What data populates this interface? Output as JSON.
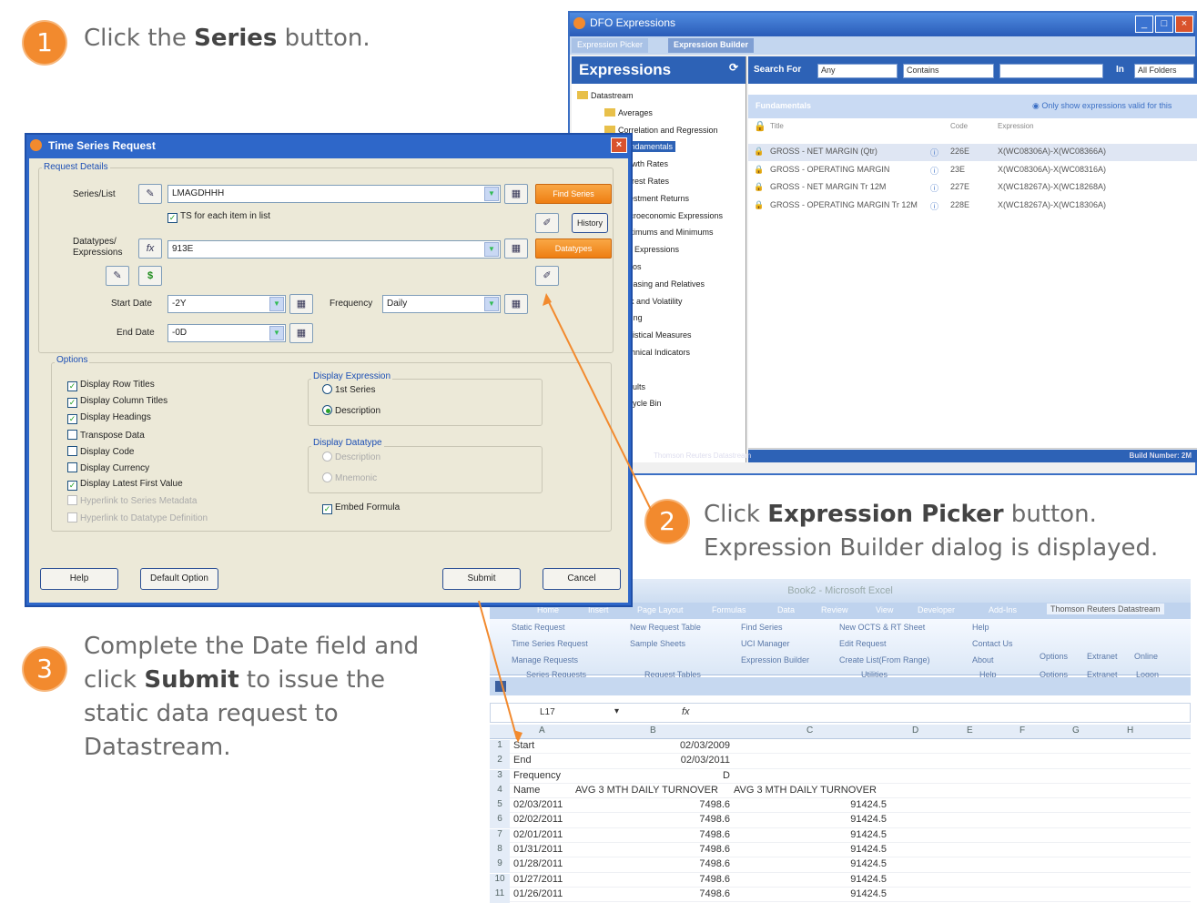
{
  "steps": [
    {
      "num": "1",
      "pre": "Click the ",
      "bold": "Series",
      "post": " button."
    },
    {
      "num": "2",
      "line1_bold": "Expression Picker",
      "line1_post": " button.",
      "line1_pre": "Click ",
      "line2": "Expression Builder  dialog is displayed."
    },
    {
      "num": "3",
      "line1": "Complete the Date field and",
      "line2_bold": "Submit",
      "line2_pre": "click ",
      "line2_post": " to issue the",
      "line3": "static data request to",
      "line4": "Datastream."
    }
  ],
  "dfo": {
    "title": "DFO Expressions",
    "tabs": [
      "Expression Picker",
      "Expression Builder"
    ],
    "panel_title": "Expressions",
    "search_for": "Search For",
    "search_any": "Any",
    "search_contains": "Contains",
    "search_in": "In",
    "search_folder": "All Folders",
    "fundamentals": "Fundamentals",
    "only_show": "Only show expressions valid for this",
    "headers": [
      "Title",
      "Code",
      "Expression"
    ],
    "tree": [
      "Datastream",
      "Averages",
      "Correlation and Regression",
      "Fundamentals",
      "Growth Rates",
      "Interest Rates",
      "Investment Returns",
      "Macroeconomic Expressions",
      "Maximums and Minimums",
      "UCI Expressions",
      "Ratios",
      "Rebasing and Relatives",
      "Risk and Volatility",
      "Timing",
      "Statistical Measures",
      "Technical Indicators",
      "",
      "Results",
      "Recycle Bin"
    ],
    "rows": [
      {
        "title": "GROSS - NET MARGIN (Qtr)",
        "code": "226E",
        "expr": "X(WC08306A)-X(WC08366A)"
      },
      {
        "title": "GROSS - OPERATING MARGIN",
        "code": "23E",
        "expr": "X(WC08306A)-X(WC08316A)"
      },
      {
        "title": "GROSS - NET MARGIN Tr 12M",
        "code": "227E",
        "expr": "X(WC18267A)-X(WC18268A)"
      },
      {
        "title": "GROSS - OPERATING MARGIN Tr 12M",
        "code": "228E",
        "expr": "X(WC18267A)-X(WC18306A)"
      }
    ],
    "status_left": "Thomson Reuters Datastream",
    "status_right": "Build Number: 2M"
  },
  "excel": {
    "title": "Book2 - Microsoft Excel",
    "tabs": [
      "Home",
      "Insert",
      "Page Layout",
      "Formulas",
      "Data",
      "Review",
      "View",
      "Developer",
      "Add-Ins",
      "Thomson Reuters Datastream"
    ],
    "ribbon": [
      "Static Request",
      "Time Series Request",
      "Manage Requests",
      "Series Requests",
      "New Request Table",
      "Sample Sheets",
      "Request Tables",
      "Find Series",
      "UCI Manager",
      "Expression Builder",
      "New OCTS & RT Sheet",
      "Edit Request",
      "Create List(From Range)",
      "Utilities",
      "Help",
      "Contact Us",
      "About",
      "Help",
      "Options",
      "Options",
      "Extranet",
      "Extranet",
      "Online",
      "Logon"
    ],
    "cell_ref": "L17",
    "columns": [
      "A",
      "B",
      "C",
      "D",
      "E",
      "F",
      "G",
      "H"
    ],
    "rows": [
      [
        "1",
        "Start",
        "02/03/2009",
        "",
        ""
      ],
      [
        "2",
        "End",
        "02/03/2011",
        "",
        ""
      ],
      [
        "3",
        "Frequency",
        "D",
        "",
        ""
      ],
      [
        "4",
        "Name",
        "AVG 3 MTH DAILY TURNOVER",
        "AVG 3 MTH DAILY TURNOVER",
        ""
      ],
      [
        "5",
        "02/03/2011",
        "",
        "7498.6",
        "91424.5"
      ],
      [
        "6",
        "02/02/2011",
        "",
        "7498.6",
        "91424.5"
      ],
      [
        "7",
        "02/01/2011",
        "",
        "7498.6",
        "91424.5"
      ],
      [
        "8",
        "01/31/2011",
        "",
        "7498.6",
        "91424.5"
      ],
      [
        "9",
        "01/28/2011",
        "",
        "7498.6",
        "91424.5"
      ],
      [
        "10",
        "01/27/2011",
        "",
        "7498.6",
        "91424.5"
      ],
      [
        "11",
        "01/26/2011",
        "",
        "7498.6",
        "91424.5"
      ]
    ]
  },
  "tsr": {
    "title": "Time Series Request",
    "request_details": "Request Details",
    "series_label": "Series/List",
    "series_value": "LMAGDHHH",
    "ts_each": "TS for each item in list",
    "find_series": "Find Series",
    "history": "History",
    "datatype_label": "Datatypes/ Expressions",
    "datatype_value": "913E",
    "datatypes_btn": "Datatypes",
    "start_label": "Start Date",
    "start_value": "-2Y",
    "end_label": "End Date",
    "end_value": "-0D",
    "freq_label": "Frequency",
    "freq_value": "Daily",
    "options": "Options",
    "checks": [
      {
        "label": "Display Row Titles",
        "on": true
      },
      {
        "label": "Display Column Titles",
        "on": true
      },
      {
        "label": "Display Headings",
        "on": true
      },
      {
        "label": "Transpose Data",
        "on": false
      },
      {
        "label": "Display Code",
        "on": false
      },
      {
        "label": "Display Currency",
        "on": false
      },
      {
        "label": "Display Latest First Value",
        "on": true
      },
      {
        "label": "Hyperlink to Series Metadata",
        "on": false
      },
      {
        "label": "Hyperlink to Datatype Definition",
        "on": false
      }
    ],
    "display_expression": "Display Expression",
    "expr_opts": [
      "1st Series",
      "Description"
    ],
    "display_datatype": "Display Datatype",
    "dt_opts": [
      "Description",
      "Mnemonic"
    ],
    "embed": "Embed Formula",
    "help": "Help",
    "default": "Default Option",
    "submit": "Submit",
    "cancel": "Cancel"
  }
}
